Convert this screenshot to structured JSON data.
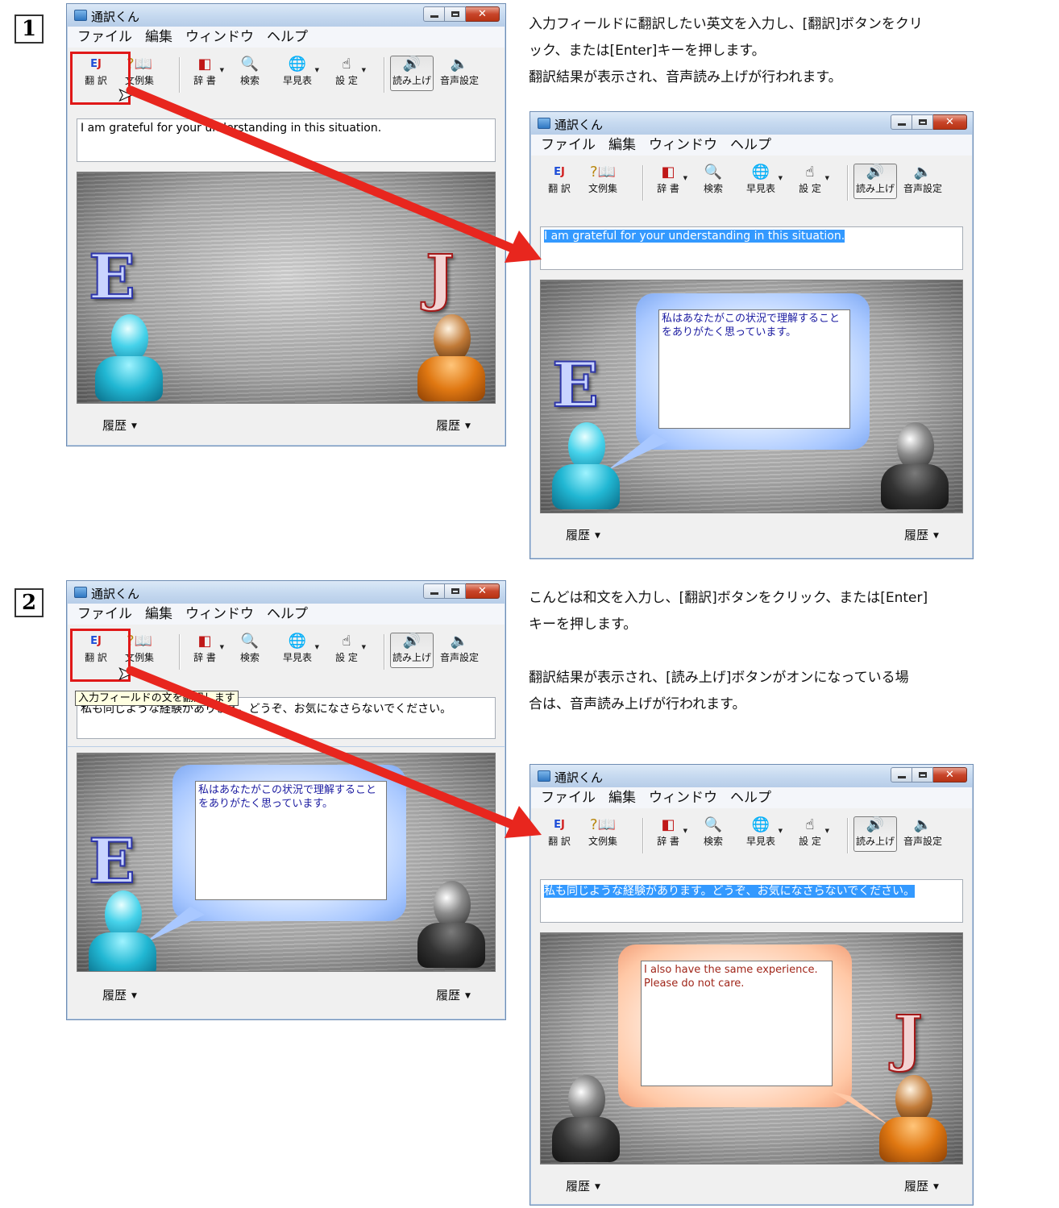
{
  "steps": [
    {
      "number": "1",
      "lines": [
        "入力フィールドに翻訳したい英文を入力し、[翻訳]ボタンをクリ",
        "ック、または[Enter]キーを押します。",
        "翻訳結果が表示され、音声読み上げが行われます。"
      ]
    },
    {
      "number": "2",
      "lines": [
        "こんどは和文を入力し、[翻訳]ボタンをクリック、または[Enter]",
        "キーを押します。",
        "",
        "翻訳結果が表示され、[読み上げ]ボタンがオンになっている場",
        "合は、音声読み上げが行われます。"
      ]
    }
  ],
  "app": {
    "title": "通訳くん",
    "menu": [
      "ファイル",
      "編集",
      "ウィンドウ",
      "ヘルプ"
    ],
    "toolbar": {
      "translate": "翻 訳",
      "examples": "文例集",
      "dictionary": "辞 書",
      "search": "検索",
      "quicklist": "早見表",
      "settings": "設 定",
      "readaloud": "読み上げ",
      "voice_settings": "音声設定"
    },
    "history": "履歴",
    "letter_e": "E",
    "letter_j": "J"
  },
  "windows": {
    "w1": {
      "input": "I am grateful for your understanding in this situation.",
      "bubble": ""
    },
    "w2": {
      "input": "I am grateful for your understanding in this situation.",
      "bubble": "私はあなたがこの状況で理解することをありがたく思っています。"
    },
    "w3": {
      "input": "私も同じような経験があります。どうぞ、お気になさらないでください。",
      "bubble": "私はあなたがこの状況で理解することをありがたく思っています。",
      "tooltip": "入力フィールドの文を翻訳します"
    },
    "w4": {
      "input": "私も同じような経験があります。どうぞ、お気になさらないでください。",
      "bubble": "I also have the same experience. Please do not care."
    }
  },
  "colors": {
    "highlight": "#e01818",
    "arrow": "#e8261e",
    "selection": "#3399ff"
  }
}
